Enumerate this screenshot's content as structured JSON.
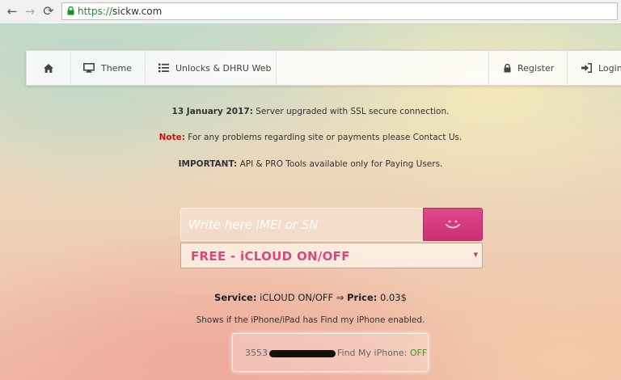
{
  "browser": {
    "url_scheme": "https://",
    "url_host": "sickw.com",
    "back_icon": "back-arrow-icon",
    "forward_icon": "forward-arrow-icon",
    "reload_icon": "reload-icon"
  },
  "navbar": {
    "home_icon": "home-icon",
    "items_left": [
      {
        "label": "Theme",
        "icon": "monitor-icon"
      },
      {
        "label": "Unlocks & DHRU Web",
        "icon": "list-icon"
      }
    ],
    "items_right": [
      {
        "label": "Register",
        "icon": "lock-icon"
      },
      {
        "label": "Login",
        "icon": "sign-in-icon"
      }
    ]
  },
  "notices": {
    "line1_bold": "13 January 2017:",
    "line1_rest": " Server upgraded with SSL secure connection.",
    "line2_label": "Note:",
    "line2_rest": " For any problems regarding site or payments please Contact Us.",
    "line3_bold": "IMPORTANT:",
    "line3_rest": " API & PRO Tools available only for Paying Users."
  },
  "search": {
    "placeholder": "Write here IMEI or SN",
    "button_icon": "smile-icon"
  },
  "service_select": {
    "selected": "FREE - iCLOUD ON/OFF"
  },
  "service_info": {
    "service_label": "Service:",
    "service_value": " iCLOUD ON/OFF ⇒ ",
    "price_label": "Price:",
    "price_value": " 0.03$",
    "description": "Shows if the iPhone/iPad has Find my iPhone enabled."
  },
  "result": {
    "imei_prefix": "3553",
    "label": "Find My iPhone: ",
    "status": "OFF"
  },
  "colors": {
    "accent_pink": "#d94a7c",
    "button_pink": "#c93075",
    "note_red": "#cc1111",
    "status_green": "#3b9a1f"
  }
}
